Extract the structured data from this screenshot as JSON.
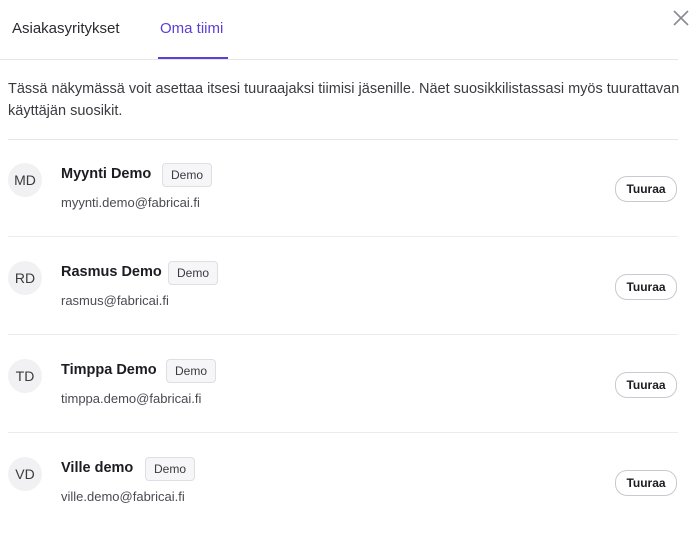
{
  "tabs": [
    {
      "label": "Asiakasyritykset",
      "active": false
    },
    {
      "label": "Oma tiimi",
      "active": true
    }
  ],
  "intro_text": "Tässä näkymässä voit asettaa itsesi tuuraajaksi tiimisi jäsenille. Näet suosikkilistassasi myös tuurattavan käyttäjän suosikit.",
  "members": [
    {
      "initials": "MD",
      "name": "Myynti Demo",
      "badge": "Demo",
      "email": "myynti.demo@fabricai.fi",
      "action": "Tuuraa"
    },
    {
      "initials": "RD",
      "name": "Rasmus Demo",
      "badge": "Demo",
      "email": "rasmus@fabricai.fi",
      "action": "Tuuraa"
    },
    {
      "initials": "TD",
      "name": "Timppa Demo",
      "badge": "Demo",
      "email": "timppa.demo@fabricai.fi",
      "action": "Tuuraa"
    },
    {
      "initials": "VD",
      "name": "Ville demo",
      "badge": "Demo",
      "email": "ville.demo@fabricai.fi",
      "action": "Tuuraa"
    }
  ],
  "colors": {
    "accent": "#5b3fd6",
    "divider": "#e6e6ea"
  },
  "icons": {
    "close": "close-icon"
  }
}
